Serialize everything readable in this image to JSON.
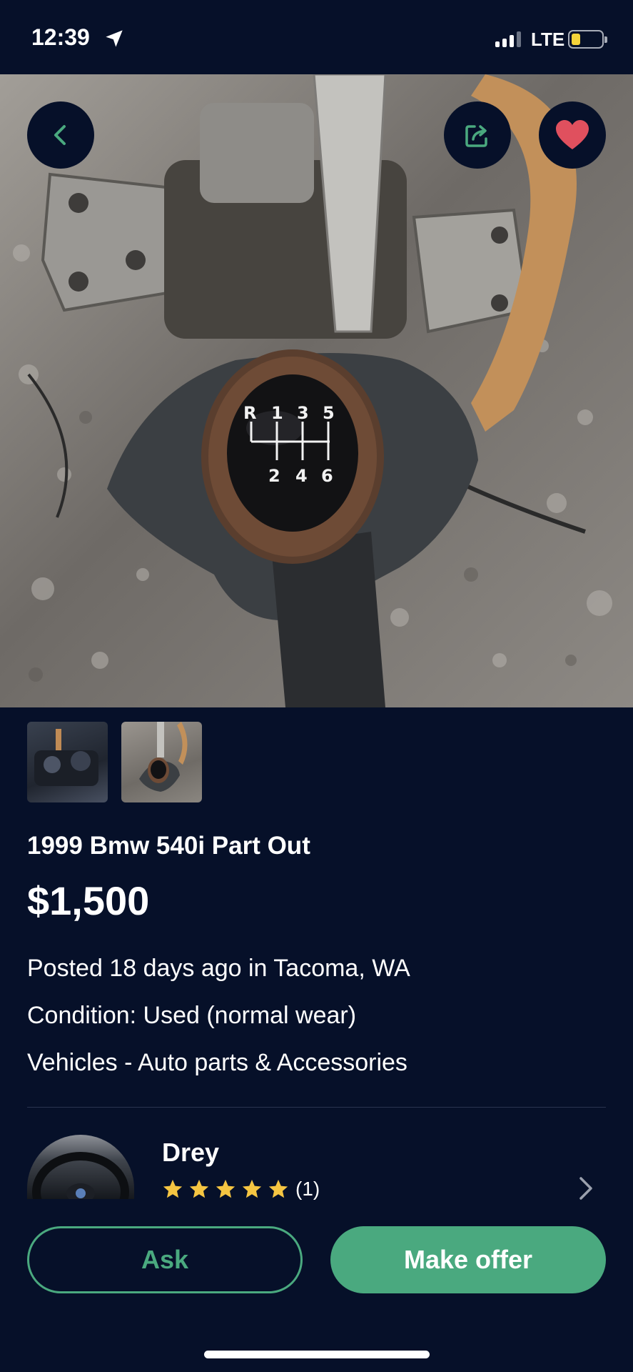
{
  "status_bar": {
    "time": "12:39",
    "network": "LTE",
    "battery_level": 0.3
  },
  "listing": {
    "title": "1999 Bmw 540i Part Out",
    "price": "$1,500",
    "posted": "Posted 18 days ago in Tacoma, WA",
    "condition": "Condition: Used (normal wear)",
    "category": "Vehicles - Auto parts & Accessories",
    "shift_pattern": {
      "top": [
        "R",
        "1",
        "3",
        "5"
      ],
      "bottom": [
        "2",
        "4",
        "6"
      ]
    }
  },
  "seller": {
    "name": "Drey",
    "rating_stars": 5,
    "rating_count": "(1)"
  },
  "actions": {
    "ask_label": "Ask",
    "offer_label": "Make offer"
  },
  "colors": {
    "background": "#061029",
    "accent": "#4aa97f",
    "favorite": "#e0505e",
    "star": "#f5c542"
  }
}
